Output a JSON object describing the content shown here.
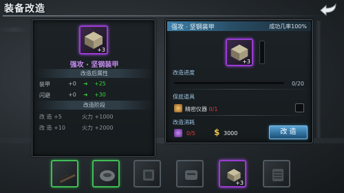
{
  "header": {
    "title": "装备改造"
  },
  "left": {
    "item_plus": "+3",
    "item_name": "强攻 · 坚钢装甲",
    "after_title": "改造后属性",
    "stats": [
      {
        "name": "装甲",
        "from": "+0",
        "to": "+25"
      },
      {
        "name": "闪避",
        "from": "+0",
        "to": "+30"
      }
    ],
    "stage_title": "改造阶段",
    "stages": [
      {
        "level": "改 造 +5",
        "bonus": "火力 +1000"
      },
      {
        "level": "改 造 +10",
        "bonus": "火力 +2000"
      }
    ]
  },
  "right": {
    "title": "强攻 · 坚钢装甲",
    "success_rate": "成功几率100%",
    "item_plus": "+3",
    "progress_label": "改造进度",
    "progress_text": "0/20",
    "progress_value": 0,
    "protect_label": "保底道具",
    "tool_name": "精密仪器",
    "tool_count": "0/1",
    "cost_label": "改造消耗",
    "material_count": "0/5",
    "gold": "3000",
    "upgrade_button": "改 造"
  },
  "inventory": {
    "slots": [
      {
        "icon": "rifle-icon",
        "frame": "green"
      },
      {
        "icon": "helmet-icon",
        "frame": "green"
      },
      {
        "icon": "chest-armor-icon",
        "frame": "grey"
      },
      {
        "icon": "boots-icon",
        "frame": "grey"
      },
      {
        "icon": "armor-box-icon",
        "frame": "purple",
        "plus": "+3"
      },
      {
        "icon": "backpack-icon",
        "frame": "grey"
      }
    ]
  },
  "colors": {
    "accent_purple": "#9b3bd6",
    "accent_green": "#37d53d",
    "accent_blue": "#3c7fa8",
    "danger_red": "#e23b3b"
  }
}
